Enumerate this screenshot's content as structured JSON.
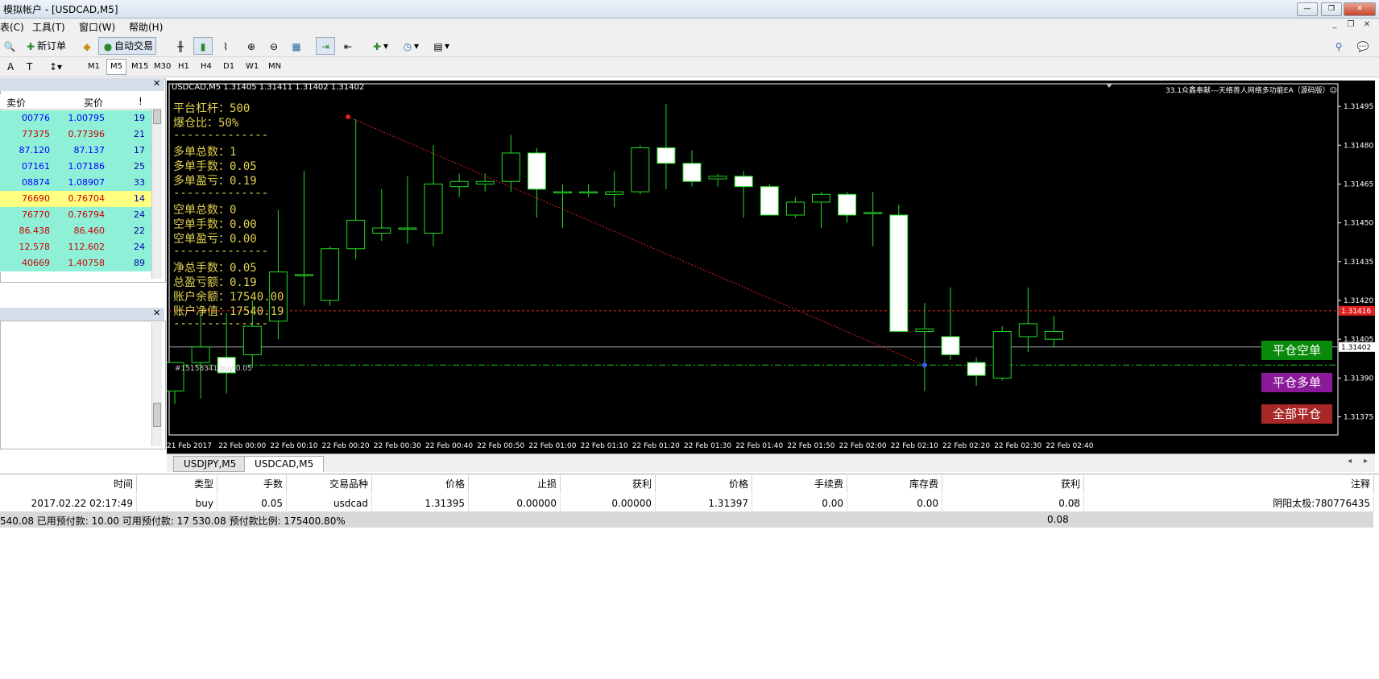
{
  "window": {
    "title": "模拟帐户 - [USDCAD,M5]"
  },
  "menu": [
    "表(C)",
    "工具(T)",
    "窗口(W)",
    "帮助(H)"
  ],
  "toolbar": {
    "new_order": "新订单",
    "auto_trade": "自动交易"
  },
  "timeframes": [
    "M1",
    "M5",
    "M15",
    "M30",
    "H1",
    "H4",
    "D1",
    "W1",
    "MN"
  ],
  "selected_timeframe": "M5",
  "market_watch": {
    "headers": [
      "卖价",
      "买价",
      "!"
    ],
    "rows": [
      {
        "bid": "00776",
        "ask": "1.00795",
        "spread": "19",
        "color": "#8ff0d8",
        "text_color": "#0000ff"
      },
      {
        "bid": "77375",
        "ask": "0.77396",
        "spread": "21",
        "color": "#8ff0d8",
        "text_color": "#cc0000"
      },
      {
        "bid": "87.120",
        "ask": "87.137",
        "spread": "17",
        "color": "#8ff0d8",
        "text_color": "#0000ff"
      },
      {
        "bid": "07161",
        "ask": "1.07186",
        "spread": "25",
        "color": "#8ff0d8",
        "text_color": "#0000ff"
      },
      {
        "bid": "08874",
        "ask": "1.08907",
        "spread": "33",
        "color": "#8ff0d8",
        "text_color": "#0000ff"
      },
      {
        "bid": "76690",
        "ask": "0.76704",
        "spread": "14",
        "color": "#ffff80",
        "text_color": "#cc0000"
      },
      {
        "bid": "76770",
        "ask": "0.76794",
        "spread": "24",
        "color": "#8ff0d8",
        "text_color": "#cc0000"
      },
      {
        "bid": "86.438",
        "ask": "86.460",
        "spread": "22",
        "color": "#8ff0d8",
        "text_color": "#cc0000"
      },
      {
        "bid": "12.578",
        "ask": "112.602",
        "spread": "24",
        "color": "#8ff0d8",
        "text_color": "#cc0000"
      },
      {
        "bid": "40669",
        "ask": "1.40758",
        "spread": "89",
        "color": "#8ff0d8",
        "text_color": "#cc0000"
      }
    ]
  },
  "chart": {
    "header": "USDCAD,M5  1.31405 1.31411 1.31402 1.31402",
    "ea_label": "33.1众鑫奉献---天络善人网络多功能EA（源码版）☺",
    "info_lines": [
      "平台杠杆：500",
      "爆仓比：50%",
      "--------------",
      "多单总数：1",
      "多单手数：0.05",
      "多单盈亏：0.19",
      "--------------",
      "空单总数：0",
      "空单手数：0.00",
      "空单盈亏：0.00",
      "--------------",
      "净总手数：0.05",
      "总盈亏额：0.19",
      "账户余额：17540.00",
      "账户净值：17540.19",
      "--------------"
    ],
    "order_label": "#15158341 buy 0.05",
    "buttons": {
      "close_short": "平仓空单",
      "close_long": "平仓多单",
      "close_all": "全部平仓"
    },
    "button_colors": {
      "close_short": "#0a8a0a",
      "close_long": "#8a1a9a",
      "close_all": "#a82828"
    },
    "price_labels": [
      "1.31495",
      "1.31480",
      "1.31465",
      "1.31450",
      "1.31435",
      "1.31420",
      "1.31405",
      "1.31390",
      "1.31375"
    ],
    "current_price": "1.31402",
    "red_line_price": "1.31416",
    "time_labels": [
      "21 Feb 2017",
      "22 Feb 00:00",
      "22 Feb 00:10",
      "22 Feb 00:20",
      "22 Feb 00:30",
      "22 Feb 00:40",
      "22 Feb 00:50",
      "22 Feb 01:00",
      "22 Feb 01:10",
      "22 Feb 01:20",
      "22 Feb 01:30",
      "22 Feb 01:40",
      "22 Feb 01:50",
      "22 Feb 02:00",
      "22 Feb 02:10",
      "22 Feb 02:20",
      "22 Feb 02:30",
      "22 Feb 02:40"
    ],
    "tabs": [
      "USDJPY,M5",
      "USDCAD,M5"
    ]
  },
  "chart_data": {
    "type": "candlestick",
    "ylim": [
      1.31368,
      1.31505
    ],
    "candles": [
      {
        "o": 1.31385,
        "h": 1.31396,
        "l": 1.3138,
        "c": 1.31396
      },
      {
        "o": 1.31396,
        "h": 1.31415,
        "l": 1.31382,
        "c": 1.31402
      },
      {
        "o": 1.31398,
        "h": 1.31415,
        "l": 1.31384,
        "c": 1.31392
      },
      {
        "o": 1.31399,
        "h": 1.3142,
        "l": 1.31394,
        "c": 1.3141
      },
      {
        "o": 1.31412,
        "h": 1.31455,
        "l": 1.31405,
        "c": 1.31431
      },
      {
        "o": 1.3143,
        "h": 1.3147,
        "l": 1.31418,
        "c": 1.3143
      },
      {
        "o": 1.3142,
        "h": 1.31441,
        "l": 1.31418,
        "c": 1.3144
      },
      {
        "o": 1.3144,
        "h": 1.3149,
        "l": 1.31436,
        "c": 1.31451
      },
      {
        "o": 1.31446,
        "h": 1.31463,
        "l": 1.31443,
        "c": 1.31448
      },
      {
        "o": 1.31448,
        "h": 1.31468,
        "l": 1.31442,
        "c": 1.31448
      },
      {
        "o": 1.31446,
        "h": 1.3148,
        "l": 1.31441,
        "c": 1.31465
      },
      {
        "o": 1.31464,
        "h": 1.31469,
        "l": 1.3146,
        "c": 1.31466
      },
      {
        "o": 1.31465,
        "h": 1.31469,
        "l": 1.31462,
        "c": 1.31466
      },
      {
        "o": 1.31466,
        "h": 1.31484,
        "l": 1.31462,
        "c": 1.31477
      },
      {
        "o": 1.31477,
        "h": 1.31479,
        "l": 1.31452,
        "c": 1.31463
      },
      {
        "o": 1.31462,
        "h": 1.31465,
        "l": 1.31448,
        "c": 1.31462
      },
      {
        "o": 1.31462,
        "h": 1.31465,
        "l": 1.3146,
        "c": 1.31462
      },
      {
        "o": 1.31461,
        "h": 1.3147,
        "l": 1.31456,
        "c": 1.31462
      },
      {
        "o": 1.31462,
        "h": 1.3148,
        "l": 1.31461,
        "c": 1.31479
      },
      {
        "o": 1.31479,
        "h": 1.31496,
        "l": 1.31463,
        "c": 1.31473
      },
      {
        "o": 1.31473,
        "h": 1.31478,
        "l": 1.31464,
        "c": 1.31466
      },
      {
        "o": 1.31467,
        "h": 1.31469,
        "l": 1.31464,
        "c": 1.31468
      },
      {
        "o": 1.31468,
        "h": 1.3147,
        "l": 1.31452,
        "c": 1.31464
      },
      {
        "o": 1.31464,
        "h": 1.31465,
        "l": 1.31453,
        "c": 1.31453
      },
      {
        "o": 1.31453,
        "h": 1.3146,
        "l": 1.31452,
        "c": 1.31458
      },
      {
        "o": 1.31458,
        "h": 1.31462,
        "l": 1.31448,
        "c": 1.31461
      },
      {
        "o": 1.31461,
        "h": 1.31462,
        "l": 1.3145,
        "c": 1.31453
      },
      {
        "o": 1.31454,
        "h": 1.31462,
        "l": 1.31441,
        "c": 1.31454
      },
      {
        "o": 1.31453,
        "h": 1.31457,
        "l": 1.31408,
        "c": 1.31408
      },
      {
        "o": 1.31408,
        "h": 1.31419,
        "l": 1.31385,
        "c": 1.31409
      },
      {
        "o": 1.31406,
        "h": 1.31425,
        "l": 1.31397,
        "c": 1.31399
      },
      {
        "o": 1.31396,
        "h": 1.31398,
        "l": 1.31387,
        "c": 1.31391
      },
      {
        "o": 1.3139,
        "h": 1.3141,
        "l": 1.31389,
        "c": 1.31408
      },
      {
        "o": 1.31406,
        "h": 1.31425,
        "l": 1.314,
        "c": 1.31411
      },
      {
        "o": 1.31405,
        "h": 1.31414,
        "l": 1.31402,
        "c": 1.31408
      }
    ]
  },
  "terminal": {
    "headers": [
      "时间",
      "类型",
      "手数",
      "交易品种",
      "价格",
      "止损",
      "获利",
      "价格",
      "手续费",
      "库存费",
      "获利",
      "注释"
    ],
    "row": [
      "2017.02.22 02:17:49",
      "buy",
      "0.05",
      "usdcad",
      "1.31395",
      "0.00000",
      "0.00000",
      "1.31397",
      "0.00",
      "0.00",
      "0.08",
      "阴阳太极:780776435"
    ],
    "summary": "540.08  已用预付款: 10.00  可用预付款: 17 530.08  预付款比例: 175400.80%",
    "summary_profit": "0.08"
  }
}
